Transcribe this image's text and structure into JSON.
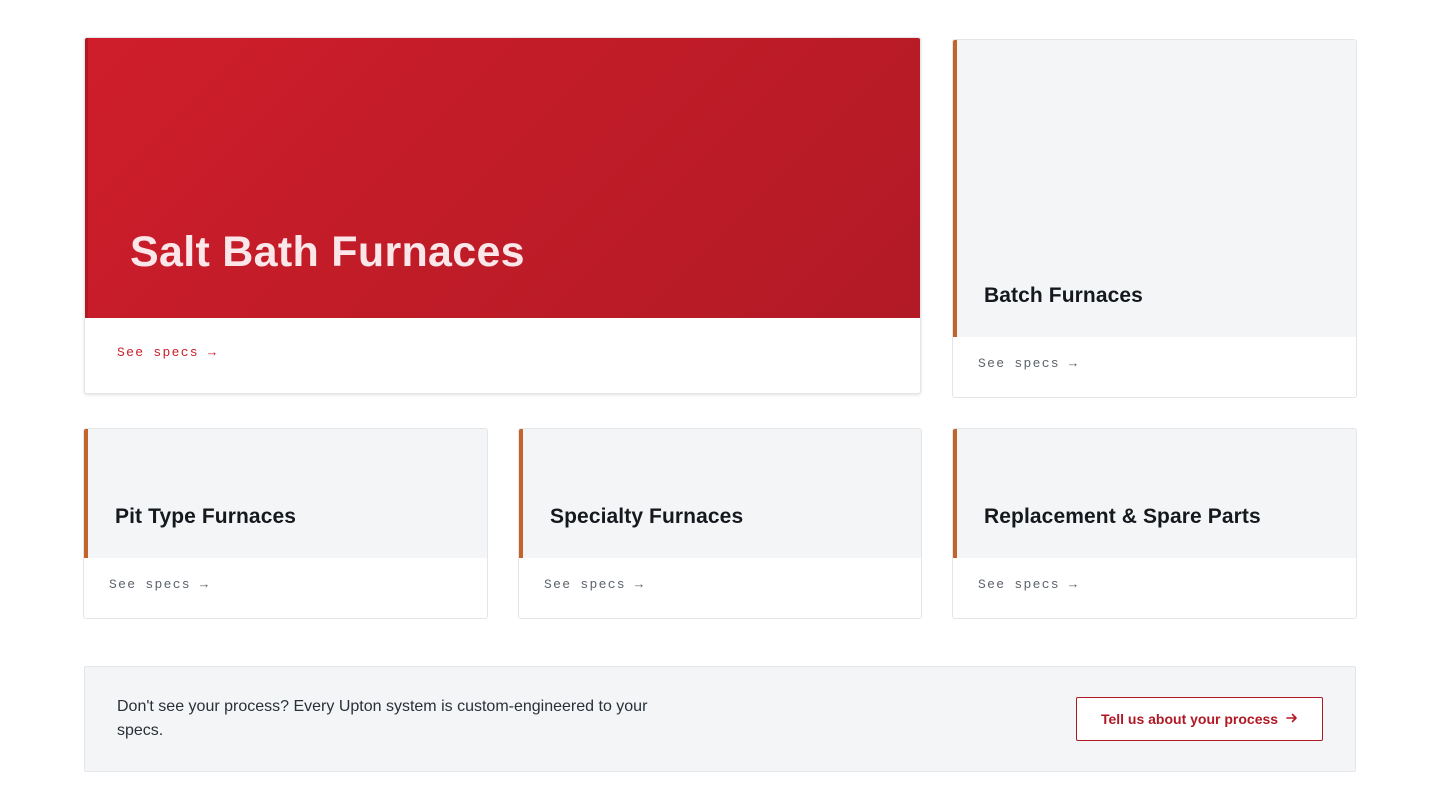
{
  "featured": {
    "title": "Salt Bath Furnaces",
    "link_label": "See specs →"
  },
  "cards": [
    {
      "title": "Batch Furnaces",
      "link_label": "See specs →"
    },
    {
      "title": "Pit Type Furnaces",
      "link_label": "See specs →"
    },
    {
      "title": "Specialty Furnaces",
      "link_label": "See specs →"
    },
    {
      "title": "Replacement & Spare Parts",
      "link_label": "See specs →"
    }
  ],
  "cta": {
    "text": "Don't see your process? Every Upton system is custom-engineered to your specs.",
    "button_label": "Tell us about your process",
    "button_icon": "arrow-right-icon"
  },
  "colors": {
    "brand_red": "#c81e2a",
    "accent_orange": "#c4642d",
    "card_bg": "#f4f5f7"
  }
}
